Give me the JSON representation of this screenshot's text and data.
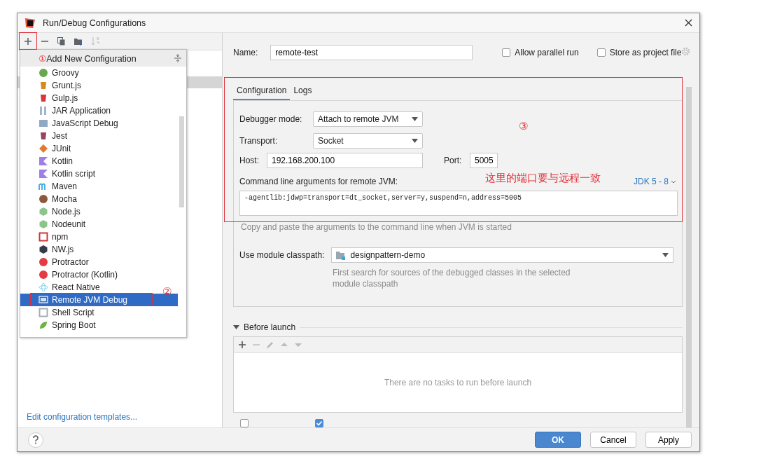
{
  "window": {
    "title": "Run/Debug Configurations"
  },
  "left_toolbar": [
    {
      "kind": "add",
      "disabled": false
    },
    {
      "kind": "remove",
      "disabled": false
    },
    {
      "kind": "copy",
      "disabled": false
    },
    {
      "kind": "folder",
      "disabled": false
    },
    {
      "kind": "sort",
      "disabled": true
    }
  ],
  "add_menu": {
    "header": "Add New Configuration",
    "items": [
      {
        "label": "Groovy",
        "selected": false
      },
      {
        "label": "Grunt.js",
        "selected": false
      },
      {
        "label": "Gulp.js",
        "selected": false
      },
      {
        "label": "JAR Application",
        "selected": false
      },
      {
        "label": "JavaScript Debug",
        "selected": false
      },
      {
        "label": "Jest",
        "selected": false
      },
      {
        "label": "JUnit",
        "selected": false
      },
      {
        "label": "Kotlin",
        "selected": false
      },
      {
        "label": "Kotlin script",
        "selected": false
      },
      {
        "label": "Maven",
        "selected": false
      },
      {
        "label": "Mocha",
        "selected": false
      },
      {
        "label": "Node.js",
        "selected": false
      },
      {
        "label": "Nodeunit",
        "selected": false
      },
      {
        "label": "npm",
        "selected": false
      },
      {
        "label": "NW.js",
        "selected": false
      },
      {
        "label": "Protractor",
        "selected": false
      },
      {
        "label": "Protractor (Kotlin)",
        "selected": false
      },
      {
        "label": "React Native",
        "selected": false
      },
      {
        "label": "Remote JVM Debug",
        "selected": true
      },
      {
        "label": "Shell Script",
        "selected": false
      },
      {
        "label": "Spring Boot",
        "selected": false
      }
    ]
  },
  "templates_link": "Edit configuration templates...",
  "annotations": {
    "step1": "①",
    "step2": "②",
    "step3": "③",
    "note": "这里的端口要与远程一致"
  },
  "name": {
    "label": "Name:",
    "value": "remote-test"
  },
  "options": [
    {
      "label": "Allow parallel run",
      "checked": false
    },
    {
      "label": "Store as project file",
      "checked": false
    }
  ],
  "tabs": [
    {
      "label": "Configuration",
      "selected": true
    },
    {
      "label": "Logs",
      "selected": false
    }
  ],
  "debugger_mode": {
    "label": "Debugger mode:",
    "value": "Attach to remote JVM"
  },
  "transport": {
    "label": "Transport:",
    "value": "Socket"
  },
  "host": {
    "label": "Host:",
    "value": "192.168.200.100"
  },
  "port": {
    "label": "Port:",
    "value": "5005"
  },
  "command_line": {
    "label": "Command line arguments for remote JVM:",
    "jdk_link": "JDK 5 - 8",
    "value": "-agentlib:jdwp=transport=dt_socket,server=y,suspend=n,address=5005",
    "hint": "Copy and paste the arguments to the command line when JVM is started"
  },
  "module_classpath": {
    "label": "Use module classpath:",
    "value": "designpattern-demo",
    "hint": "First search for sources of the debugged classes in the selected module classpath"
  },
  "before_launch": {
    "title": "Before launch",
    "expanded": true,
    "empty_text": "There are no tasks to run before launch"
  },
  "bottom_options": [
    {
      "checked": false
    },
    {
      "checked": true
    }
  ],
  "buttons": [
    {
      "label": "OK",
      "kind": "primary"
    },
    {
      "label": "Cancel",
      "kind": "normal"
    },
    {
      "label": "Apply",
      "kind": "normal"
    }
  ]
}
